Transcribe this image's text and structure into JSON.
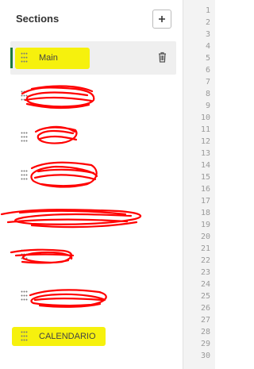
{
  "panel": {
    "title": "Sections",
    "add_icon": "plus-icon"
  },
  "sections": [
    {
      "label": "Main",
      "active": true,
      "redacted": false,
      "highlighted": true
    },
    {
      "label": "",
      "redacted": true
    },
    {
      "label": "",
      "redacted": true
    },
    {
      "label": "",
      "redacted": true
    },
    {
      "label": "",
      "redacted": true
    },
    {
      "label": "",
      "redacted": true
    },
    {
      "label": "",
      "redacted": true
    },
    {
      "label": "CALENDARIO",
      "redacted": false,
      "highlighted": true
    }
  ],
  "icons": {
    "drag_handle": "grip-dots-icon",
    "delete": "trash-icon"
  },
  "colors": {
    "accent": "#1f7a3f",
    "highlight": "#f5f000",
    "redaction": "#ff0000",
    "active_row_bg": "#efefef"
  },
  "line_numbers": [
    "1",
    "2",
    "3",
    "4",
    "5",
    "6",
    "7",
    "8",
    "9",
    "10",
    "11",
    "12",
    "13",
    "14",
    "15",
    "16",
    "17",
    "18",
    "19",
    "20",
    "21",
    "22",
    "23",
    "24",
    "25",
    "26",
    "27",
    "28",
    "29",
    "30"
  ]
}
